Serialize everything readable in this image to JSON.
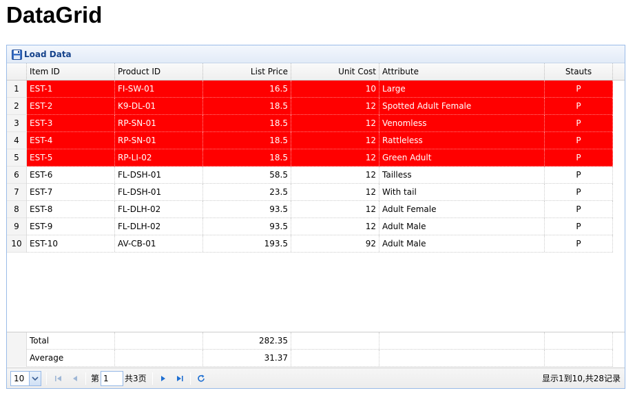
{
  "page": {
    "title": "DataGrid"
  },
  "toolbar": {
    "load_label": "Load Data"
  },
  "columns": [
    "Item ID",
    "Product ID",
    "List Price",
    "Unit Cost",
    "Attribute",
    "Stauts"
  ],
  "rows": [
    {
      "num": "1",
      "itemid": "EST-1",
      "productid": "FI-SW-01",
      "listprice": "16.5",
      "unitcost": "10",
      "attr": "Large",
      "status": "P",
      "selected": true
    },
    {
      "num": "2",
      "itemid": "EST-2",
      "productid": "K9-DL-01",
      "listprice": "18.5",
      "unitcost": "12",
      "attr": "Spotted Adult Female",
      "status": "P",
      "selected": true
    },
    {
      "num": "3",
      "itemid": "EST-3",
      "productid": "RP-SN-01",
      "listprice": "18.5",
      "unitcost": "12",
      "attr": "Venomless",
      "status": "P",
      "selected": true
    },
    {
      "num": "4",
      "itemid": "EST-4",
      "productid": "RP-SN-01",
      "listprice": "18.5",
      "unitcost": "12",
      "attr": "Rattleless",
      "status": "P",
      "selected": true
    },
    {
      "num": "5",
      "itemid": "EST-5",
      "productid": "RP-LI-02",
      "listprice": "18.5",
      "unitcost": "12",
      "attr": "Green Adult",
      "status": "P",
      "selected": true
    },
    {
      "num": "6",
      "itemid": "EST-6",
      "productid": "FL-DSH-01",
      "listprice": "58.5",
      "unitcost": "12",
      "attr": "Tailless",
      "status": "P",
      "selected": false
    },
    {
      "num": "7",
      "itemid": "EST-7",
      "productid": "FL-DSH-01",
      "listprice": "23.5",
      "unitcost": "12",
      "attr": "With tail",
      "status": "P",
      "selected": false
    },
    {
      "num": "8",
      "itemid": "EST-8",
      "productid": "FL-DLH-02",
      "listprice": "93.5",
      "unitcost": "12",
      "attr": "Adult Female",
      "status": "P",
      "selected": false
    },
    {
      "num": "9",
      "itemid": "EST-9",
      "productid": "FL-DLH-02",
      "listprice": "93.5",
      "unitcost": "12",
      "attr": "Adult Male",
      "status": "P",
      "selected": false
    },
    {
      "num": "10",
      "itemid": "EST-10",
      "productid": "AV-CB-01",
      "listprice": "193.5",
      "unitcost": "92",
      "attr": "Adult Male",
      "status": "P",
      "selected": false
    }
  ],
  "footer": [
    {
      "label": "Total",
      "listprice": "282.35"
    },
    {
      "label": "Average",
      "listprice": "31.37"
    }
  ],
  "pager": {
    "page_size": "10",
    "page_prefix": "第",
    "page_value": "1",
    "page_suffix": "共3页",
    "info": "显示1到10,共28记录"
  },
  "colors": {
    "selected_bg": "#ff0000",
    "accent": "#15428b",
    "border": "#99bbe8"
  },
  "icons": {
    "load": "save-disk-icon",
    "first": "first-page-icon",
    "prev": "prev-page-icon",
    "next": "next-page-icon",
    "last": "last-page-icon",
    "refresh": "refresh-icon",
    "dropdown": "chevron-down-icon"
  }
}
